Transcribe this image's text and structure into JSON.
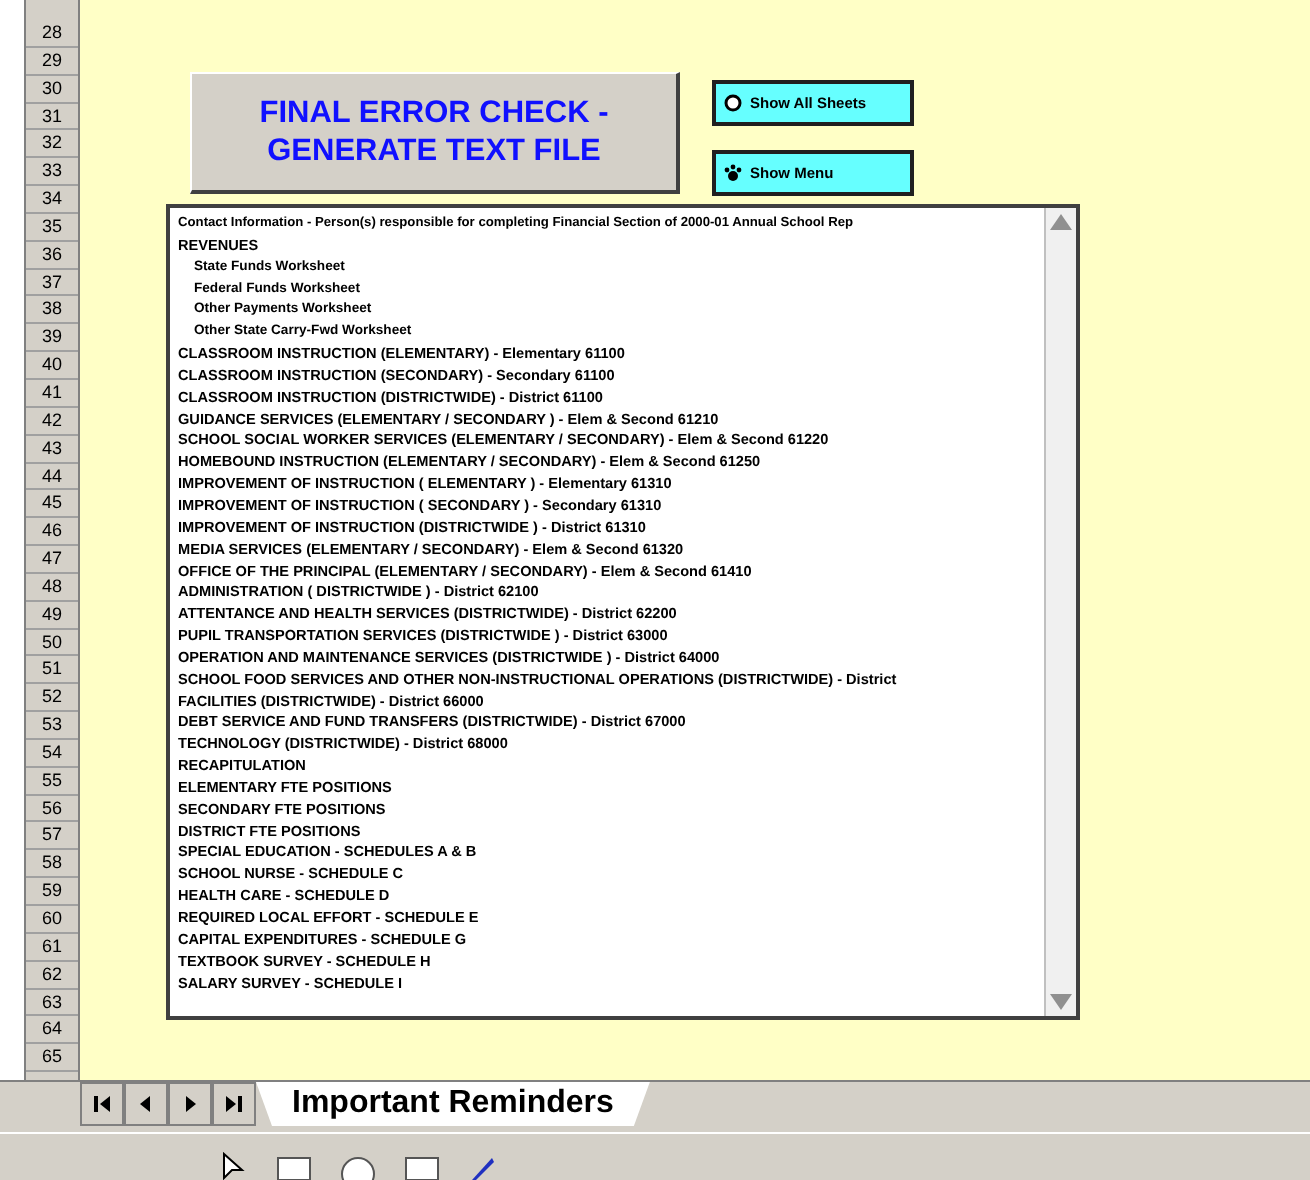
{
  "row_headers": [
    "28",
    "29",
    "30",
    "31",
    "32",
    "33",
    "34",
    "35",
    "36",
    "37",
    "38",
    "39",
    "40",
    "41",
    "42",
    "43",
    "44",
    "45",
    "46",
    "47",
    "48",
    "49",
    "50",
    "51",
    "52",
    "53",
    "54",
    "55",
    "56",
    "57",
    "58",
    "59",
    "60",
    "61",
    "62",
    "63",
    "64",
    "65"
  ],
  "main_button": {
    "label": "FINAL ERROR CHECK - GENERATE TEXT FILE"
  },
  "side_buttons": [
    {
      "label": "Show All Sheets",
      "kind": "sheets"
    },
    {
      "label": "Show Menu",
      "kind": "menu"
    }
  ],
  "list_box": {
    "items": [
      {
        "label": "Contact Information - Person(s) responsible for completing Financial Section of 2000-01 Annual School Rep",
        "kind": "info"
      },
      {
        "label": "REVENUES",
        "children": [
          {
            "label": "State Funds Worksheet"
          },
          {
            "label": "Federal Funds Worksheet"
          },
          {
            "label": "Other Payments Worksheet"
          },
          {
            "label": "Other State Carry-Fwd Worksheet"
          }
        ]
      },
      {
        "label": "CLASSROOM INSTRUCTION (ELEMENTARY) - Elementary 61100"
      },
      {
        "label": "CLASSROOM INSTRUCTION (SECONDARY) - Secondary 61100"
      },
      {
        "label": "CLASSROOM INSTRUCTION (DISTRICTWIDE) - District 61100"
      },
      {
        "label": "GUIDANCE SERVICES (ELEMENTARY / SECONDARY ) - Elem & Second 61210"
      },
      {
        "label": "SCHOOL SOCIAL WORKER SERVICES (ELEMENTARY / SECONDARY) - Elem & Second 61220"
      },
      {
        "label": "HOMEBOUND INSTRUCTION (ELEMENTARY / SECONDARY) - Elem & Second 61250"
      },
      {
        "label": "IMPROVEMENT OF INSTRUCTION ( ELEMENTARY ) - Elementary 61310"
      },
      {
        "label": "IMPROVEMENT OF INSTRUCTION ( SECONDARY ) - Secondary 61310"
      },
      {
        "label": "IMPROVEMENT OF INSTRUCTION (DISTRICTWIDE ) - District 61310"
      },
      {
        "label": "MEDIA SERVICES (ELEMENTARY / SECONDARY) - Elem & Second 61320"
      },
      {
        "label": "OFFICE OF THE PRINCIPAL (ELEMENTARY / SECONDARY) - Elem & Second 61410"
      },
      {
        "label": "ADMINISTRATION ( DISTRICTWIDE ) - District 62100"
      },
      {
        "label": "ATTENTANCE AND HEALTH SERVICES (DISTRICTWIDE) - District 62200"
      },
      {
        "label": "PUPIL TRANSPORTATION SERVICES (DISTRICTWIDE ) - District 63000"
      },
      {
        "label": "OPERATION AND MAINTENANCE SERVICES (DISTRICTWIDE ) - District 64000"
      },
      {
        "label": "SCHOOL FOOD SERVICES AND OTHER NON-INSTRUCTIONAL OPERATIONS (DISTRICTWIDE) - District"
      },
      {
        "label": "FACILITIES (DISTRICTWIDE) - District 66000"
      },
      {
        "label": "DEBT SERVICE AND FUND TRANSFERS (DISTRICTWIDE) - District 67000"
      },
      {
        "label": "TECHNOLOGY (DISTRICTWIDE) - District 68000"
      },
      {
        "label": "RECAPITULATION"
      },
      {
        "label": "ELEMENTARY FTE POSITIONS"
      },
      {
        "label": "SECONDARY FTE POSITIONS"
      },
      {
        "label": "DISTRICT FTE POSITIONS"
      },
      {
        "label": "SPECIAL EDUCATION - SCHEDULES A & B"
      },
      {
        "label": "SCHOOL NURSE - SCHEDULE C"
      },
      {
        "label": "HEALTH CARE - SCHEDULE D"
      },
      {
        "label": "REQUIRED LOCAL EFFORT - SCHEDULE E"
      },
      {
        "label": "CAPITAL EXPENDITURES - SCHEDULE G"
      },
      {
        "label": "TEXTBOOK SURVEY - SCHEDULE H"
      },
      {
        "label": "SALARY SURVEY - SCHEDULE I"
      }
    ]
  },
  "sheet_tabs": [
    {
      "label": "Important Reminders",
      "selected": true
    }
  ]
}
